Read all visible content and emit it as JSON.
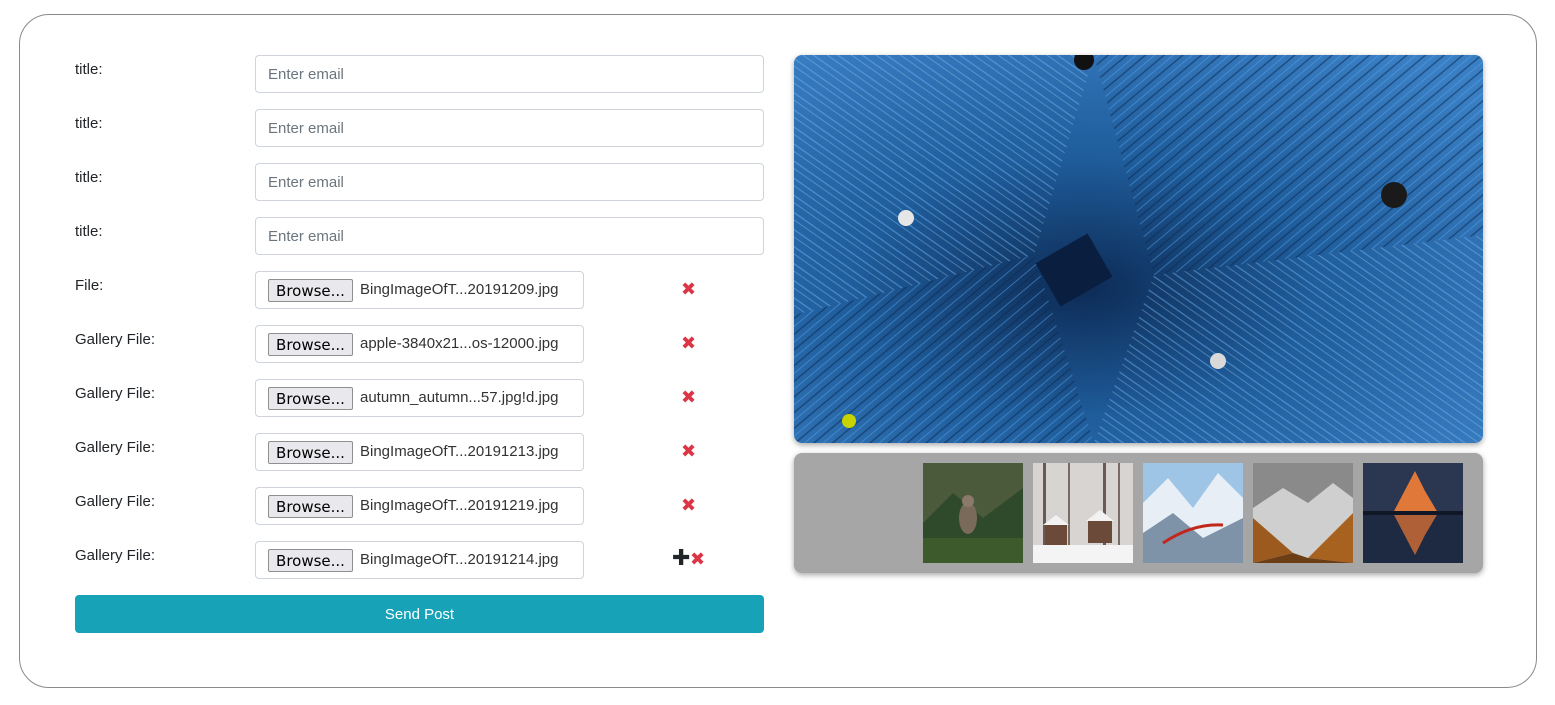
{
  "form": {
    "text_fields": [
      {
        "label": "title:",
        "placeholder": "Enter email"
      },
      {
        "label": "title:",
        "placeholder": "Enter email"
      },
      {
        "label": "title:",
        "placeholder": "Enter email"
      },
      {
        "label": "title:",
        "placeholder": "Enter email"
      }
    ],
    "file_fields": [
      {
        "label": "File:",
        "button": "Browse...",
        "filename": "BingImageOfT...20191209.jpg",
        "remove_icon": "✖"
      },
      {
        "label": "Gallery File:",
        "button": "Browse...",
        "filename": "apple-3840x21...os-12000.jpg",
        "remove_icon": "✖"
      },
      {
        "label": "Gallery File:",
        "button": "Browse...",
        "filename": "autumn_autumn...57.jpg!d.jpg",
        "remove_icon": "✖"
      },
      {
        "label": "Gallery File:",
        "button": "Browse...",
        "filename": "BingImageOfT...20191213.jpg",
        "remove_icon": "✖"
      },
      {
        "label": "Gallery File:",
        "button": "Browse...",
        "filename": "BingImageOfT...20191219.jpg",
        "remove_icon": "✖"
      },
      {
        "label": "Gallery File:",
        "button": "Browse...",
        "filename": "BingImageOfT...20191214.jpg",
        "remove_icon": "✖",
        "add_icon": "✚"
      }
    ],
    "submit_label": "Send Post"
  },
  "colors": {
    "accent": "#17a2b8",
    "remove": "#dc3545",
    "gallery_bg": "#a6a6a6",
    "card_border": "#8a8a8a"
  },
  "preview": {
    "main_image": "circuit-board-photo",
    "thumbnails": [
      "bird-on-pine-photo",
      "snowy-cabins-photo",
      "mountain-train-photo",
      "autumn-valley-photo",
      "matterhorn-lake-photo"
    ]
  }
}
